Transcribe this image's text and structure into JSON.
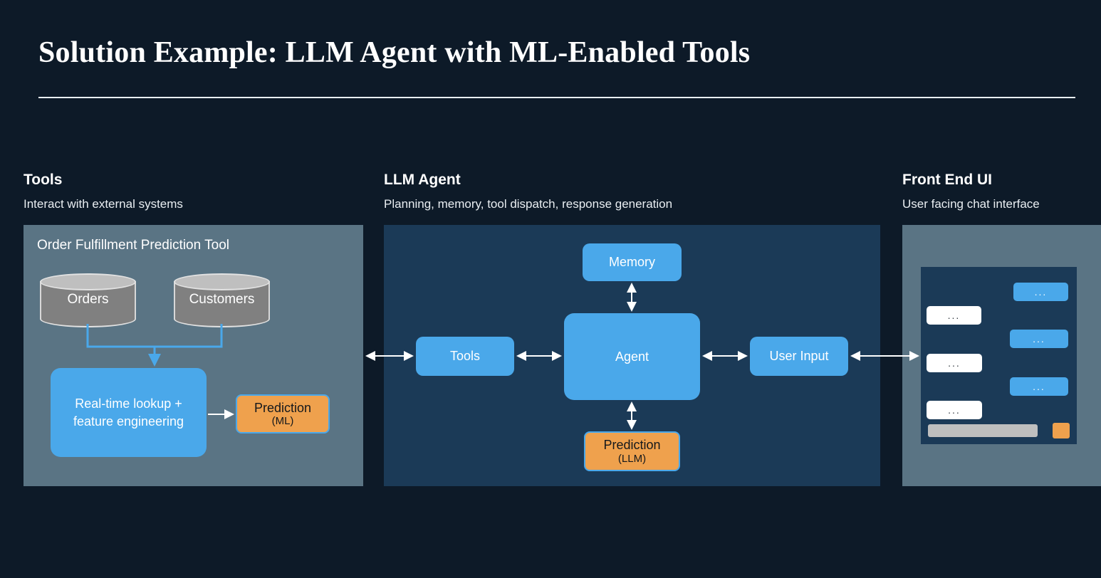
{
  "slide": {
    "title": "Solution Example: LLM Agent with ML-Enabled Tools"
  },
  "columns": {
    "tools": {
      "title": "Tools",
      "subtitle": "Interact with external systems"
    },
    "agent": {
      "title": "LLM Agent",
      "subtitle": "Planning, memory, tool dispatch, response generation"
    },
    "frontend": {
      "title": "Front End UI",
      "subtitle": "User facing chat interface"
    }
  },
  "tools_panel": {
    "card_title": "Order Fulfillment Prediction Tool",
    "databases": [
      {
        "label": "Orders"
      },
      {
        "label": "Customers"
      }
    ],
    "lookup_box": "Real-time lookup +\nfeature engineering",
    "lookup_box_line1": "Real-time lookup +",
    "lookup_box_line2": "feature engineering",
    "prediction_box": {
      "main": "Prediction",
      "sub": "(ML)"
    }
  },
  "agent_panel": {
    "memory": "Memory",
    "agent": "Agent",
    "tools": "Tools",
    "user_input": "User Input",
    "prediction_box": {
      "main": "Prediction",
      "sub": "(LLM)"
    }
  },
  "frontend_panel": {
    "messages": [
      {
        "side": "user",
        "text": "..."
      },
      {
        "side": "bot",
        "text": "..."
      },
      {
        "side": "user",
        "text": "..."
      },
      {
        "side": "bot",
        "text": "..."
      },
      {
        "side": "user",
        "text": "..."
      },
      {
        "side": "bot",
        "text": "..."
      }
    ],
    "input_placeholder": "",
    "send_label": ""
  },
  "colors": {
    "background": "#0d1a28",
    "panel_slate": "#5a7484",
    "panel_navy": "#1b3a57",
    "accent_blue": "#4aa8ea",
    "accent_orange": "#efa14d",
    "database_gray": "#808080",
    "input_gray": "#bfbfbf",
    "text_white": "#ffffff"
  }
}
